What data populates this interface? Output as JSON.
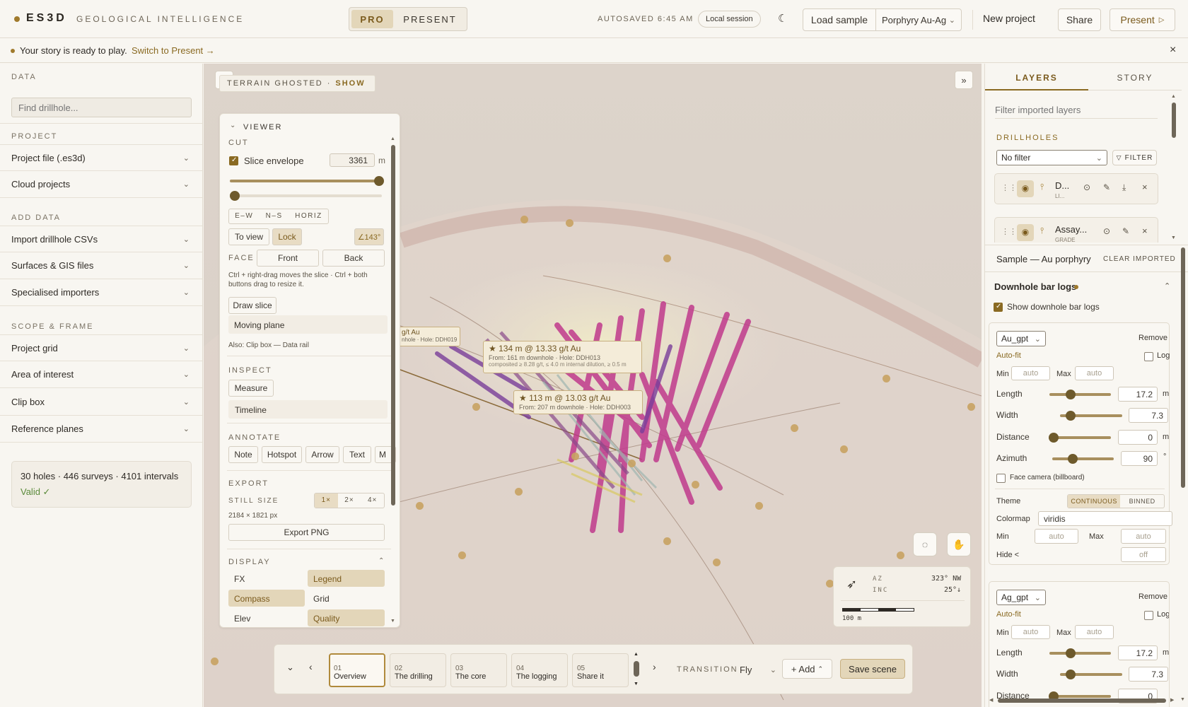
{
  "app": {
    "logo": "ES3D",
    "tagline": "GEOLOGICAL INTELLIGENCE"
  },
  "mode": {
    "pro": "PRO",
    "present": "PRESENT"
  },
  "topbar": {
    "autosaved": "AUTOSAVED 6:45 AM",
    "session": "Local session",
    "load_sample": "Load sample",
    "sample_select": "Porphyry Au-Ag",
    "new_project": "New project",
    "share": "Share",
    "present": "Present"
  },
  "notice": {
    "text": "Your story is ready to play.",
    "link": "Switch to Present →"
  },
  "left": {
    "data_title": "DATA",
    "search_placeholder": "Find drillhole...",
    "project_title": "PROJECT",
    "project_items": [
      "Project file (.es3d)",
      "Cloud projects"
    ],
    "add_title": "ADD DATA",
    "add_items": [
      "Import drillhole CSVs",
      "Surfaces & GIS files",
      "Specialised importers"
    ],
    "scope_title": "SCOPE & FRAME",
    "scope_items": [
      "Project grid",
      "Area of interest",
      "Clip box",
      "Reference planes"
    ],
    "summary": "30 holes · 446 surveys · 4101 intervals",
    "valid": "Valid ✓"
  },
  "viewport": {
    "terrain_label": "TERRAIN GHOSTED",
    "terrain_show": "SHOW",
    "callouts": [
      {
        "title": "★ 134 m @ 13.33 g/t Au",
        "sub": "From: 161 m downhole · Hole: DDH013",
        "note": "composited ≥ 8.28 g/t, ≤ 4.0 m internal dilution, ≥ 0.5 m"
      },
      {
        "title": "★ 113 m @ 13.03 g/t Au",
        "sub": "From: 207 m downhole · Hole: DDH003"
      },
      {
        "title": "g/t Au",
        "sub": "nhole · Hole: DDH019"
      }
    ],
    "compass": {
      "az_label": "AZ",
      "az_value": "323° NW",
      "inc_label": "INC",
      "inc_value": "25°↓",
      "scale": "100 m"
    }
  },
  "viewer": {
    "title": "VIEWER",
    "cut": "CUT",
    "slice_label": "Slice envelope",
    "slice_value": "3361",
    "slice_unit": "m",
    "axes": [
      "E–W",
      "N–S",
      "HORIZ"
    ],
    "to_view": "To view",
    "lock": "Lock",
    "angle": "∠143°",
    "face": "FACE",
    "front": "Front",
    "back": "Back",
    "hint": "Ctrl + right-drag moves the slice · Ctrl + both buttons drag to resize it.",
    "draw_slice": "Draw slice",
    "moving_plane": "Moving plane",
    "also": "Also: Clip box — Data rail",
    "inspect": "INSPECT",
    "measure": "Measure",
    "timeline": "Timeline",
    "annotate": "ANNOTATE",
    "annotate_items": [
      "Note",
      "Hotspot",
      "Arrow",
      "Text",
      "M"
    ],
    "export": "EXPORT",
    "still_size": "STILL SIZE",
    "sizes": [
      "1×",
      "2×",
      "4×"
    ],
    "dims": "2184 × 1821 px",
    "export_png": "Export PNG",
    "display": "DISPLAY",
    "display_items": [
      "FX",
      "Legend",
      "Compass",
      "Grid",
      "Elev",
      "Quality"
    ]
  },
  "story": {
    "scenes": [
      {
        "num": "01",
        "name": "Overview"
      },
      {
        "num": "02",
        "name": "The drilling"
      },
      {
        "num": "03",
        "name": "The core"
      },
      {
        "num": "04",
        "name": "The logging"
      },
      {
        "num": "05",
        "name": "Share it"
      }
    ],
    "transition_label": "TRANSITION",
    "transition_value": "Fly",
    "add": "+ Add",
    "save": "Save scene"
  },
  "right": {
    "tabs": [
      "LAYERS",
      "STORY"
    ],
    "filter_placeholder": "Filter imported layers",
    "drillholes_title": "DRILLHOLES",
    "no_filter": "No filter",
    "filter_btn": "FILTER",
    "layers": [
      {
        "name": "D...",
        "sub": "LI..."
      },
      {
        "name": "Assay...",
        "sub": "GRADE"
      }
    ],
    "sample": "Sample — Au porphyry",
    "clear": "CLEAR IMPORTED",
    "bar_logs_title": "Downhole bar logs",
    "show_bar_logs": "Show downhole bar logs",
    "blocks": [
      {
        "field": "Au_gpt",
        "remove": "Remove",
        "autofit": "Auto-fit",
        "log": "Log",
        "min": "Min",
        "max": "Max",
        "auto": "auto",
        "length_label": "Length",
        "length": "17.2",
        "length_unit": "m",
        "width_label": "Width",
        "width": "7.3",
        "distance_label": "Distance",
        "distance": "0",
        "distance_unit": "m",
        "azimuth_label": "Azimuth",
        "azimuth": "90",
        "azimuth_unit": "°",
        "face_camera": "Face camera (billboard)",
        "theme": "Theme",
        "continuous": "CONTINUOUS",
        "binned": "BINNED",
        "colormap_label": "Colormap",
        "colormap": "viridis",
        "hide": "Hide <",
        "off": "off"
      },
      {
        "field": "Ag_gpt",
        "remove": "Remove",
        "autofit": "Auto-fit",
        "log": "Log",
        "min": "Min",
        "max": "Max",
        "auto": "auto",
        "length_label": "Length",
        "length": "17.2",
        "length_unit": "m",
        "width_label": "Width",
        "width": "7.3",
        "distance_label": "Distance",
        "distance": "0"
      }
    ]
  }
}
